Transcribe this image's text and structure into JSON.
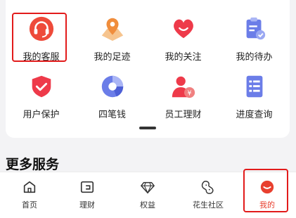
{
  "grid": [
    {
      "label": "我的客服",
      "icon": "headset-icon"
    },
    {
      "label": "我的足迹",
      "icon": "location-pin-icon"
    },
    {
      "label": "我的关注",
      "icon": "heart-icon"
    },
    {
      "label": "我的待办",
      "icon": "clipboard-check-icon"
    },
    {
      "label": "用户保护",
      "icon": "shield-check-icon"
    },
    {
      "label": "四笔钱",
      "icon": "pie-chart-icon"
    },
    {
      "label": "员工理财",
      "icon": "employee-finance-icon"
    },
    {
      "label": "进度查询",
      "icon": "progress-list-icon"
    }
  ],
  "section_title": "更多服务",
  "tabs": [
    {
      "label": "首页",
      "icon": "home-icon"
    },
    {
      "label": "理财",
      "icon": "wallet-icon"
    },
    {
      "label": "权益",
      "icon": "diamond-icon"
    },
    {
      "label": "花生社区",
      "icon": "peanut-icon"
    },
    {
      "label": "我的",
      "icon": "profile-icon"
    }
  ],
  "colors": {
    "accent": "#e8402f",
    "highlight": "#e21b1b",
    "orange": "#f0a55a",
    "purple": "#6b7de8"
  }
}
